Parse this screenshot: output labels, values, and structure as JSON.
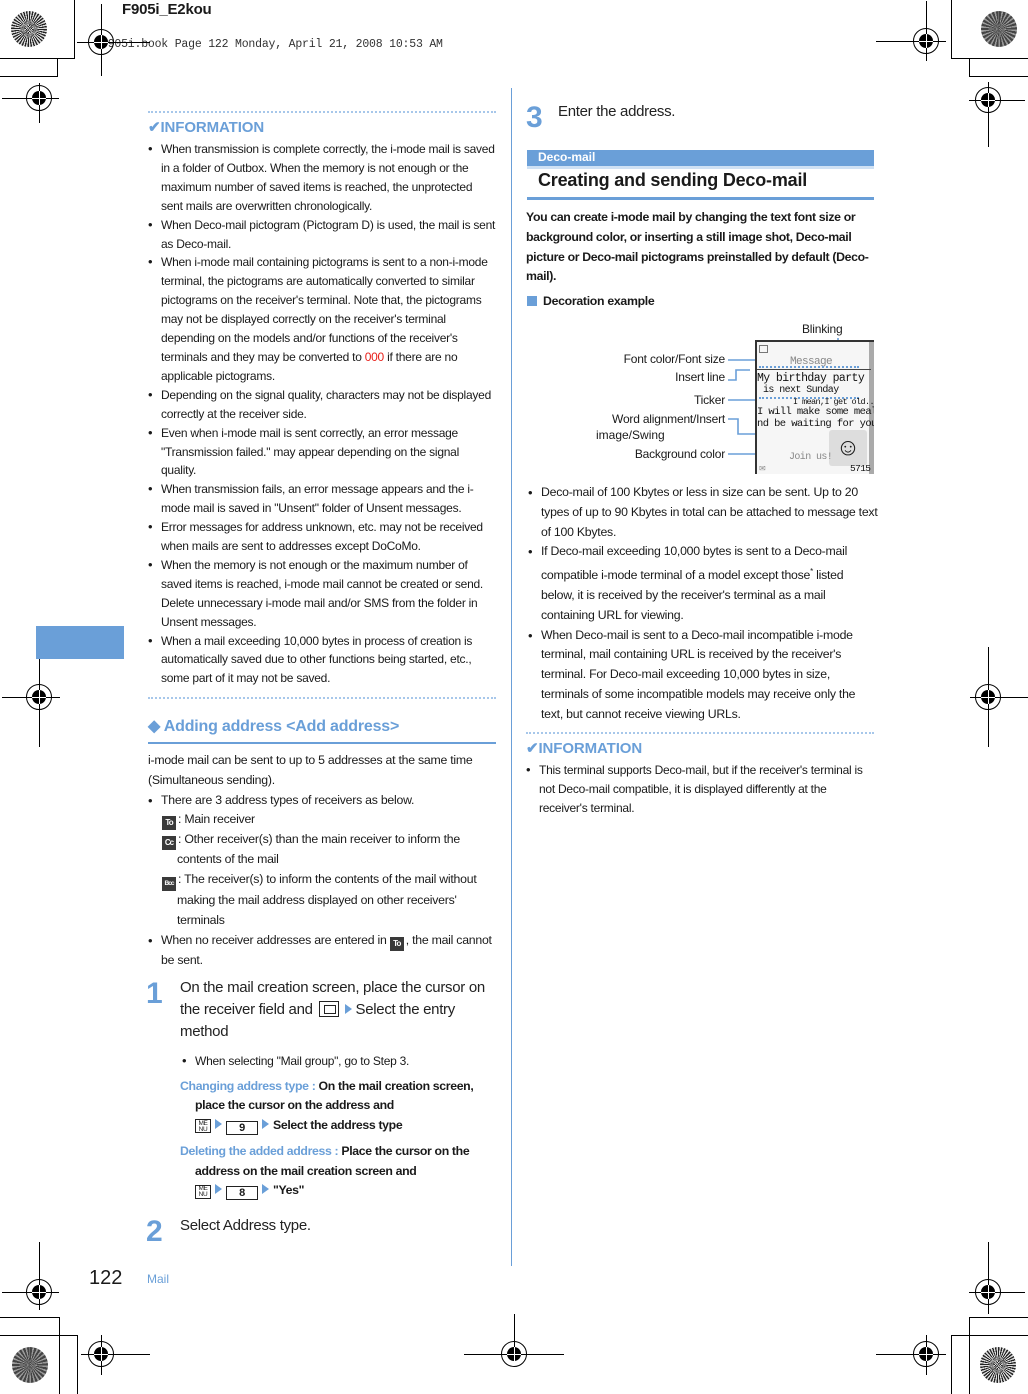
{
  "header": {
    "job_name": "F905i_E2kou",
    "print_stamp": "F905i.book  Page 122  Monday, April 21, 2008  10:53 AM"
  },
  "footer": {
    "page_number": "122",
    "section": "Mail"
  },
  "left_column": {
    "info_box": {
      "title_icon": "check-icon",
      "title": "INFORMATION",
      "bullets": [
        "When transmission is complete correctly, the i-mode mail is saved in a folder of Outbox. When the memory is not enough or the maximum number of saved items is reached, the unprotected sent mails are overwritten chronologically.",
        "When Deco-mail pictogram (Pictogram D) is used, the mail is sent as Deco-mail.",
        {
          "before": "When i-mode mail containing pictograms is sent to a non-i-mode terminal, the pictograms are automatically converted to similar pictograms on the receiver's terminal. Note that, the pictograms may not be displayed correctly on the receiver's terminal depending on the models and/or functions of the receiver's terminals and they may be converted to ",
          "highlight": "000",
          "after": " if there are no applicable pictograms."
        },
        "Depending on the signal quality, characters may not be displayed correctly at the receiver side.",
        "Even when i-mode mail is sent correctly, an error message \"Transmission failed.\" may appear depending on the signal quality.",
        "When transmission fails, an error message appears and the i-mode mail is saved in \"Unsent\" folder of Unsent messages.",
        "Error messages for address unknown, etc. may not be received when mails are sent to addresses except DoCoMo.",
        "When the memory is not enough or the maximum number of saved items is reached, i-mode mail cannot be created or send. Delete unnecessary i-mode mail and/or SMS from the folder in Unsent messages.",
        "When a mail exceeding 10,000 bytes in process of creation is automatically saved due to other functions being started, etc., some part of it may not be saved."
      ]
    },
    "add_address": {
      "heading_icon": "diamond-icon",
      "heading": "Adding address <Add address>",
      "intro": "i-mode mail can be sent to up to 5 addresses at the same time (Simultaneous sending).",
      "bullet_types": "There are 3 address types of receivers as below.",
      "types": [
        {
          "badge": "To",
          "text": ": Main receiver"
        },
        {
          "badge": "Cc",
          "text": ": Other receiver(s) than the main receiver to inform the contents of the mail"
        },
        {
          "badge": "Bcc",
          "text": ": The receiver(s) to inform the contents of the mail without making the mail address displayed on other receivers' terminals"
        }
      ],
      "bullet_no_receiver_before": "When no receiver addresses are entered in",
      "bullet_no_receiver_badge": "To",
      "bullet_no_receiver_after": ", the mail cannot be sent."
    },
    "steps": [
      {
        "number": "1",
        "text_before": "On the mail creation screen, place the cursor on the receiver field and",
        "key_icon": "mail-key-icon",
        "text_after": "Select the entry method",
        "sub_bullet": "When selecting \"Mail group\", go to Step 3.",
        "operations": [
          {
            "label": "Changing address type :",
            "text_before": "On the mail creation screen, place the cursor on the address and",
            "menu_key": "MENU",
            "key": "9",
            "text_after": "Select the address type"
          },
          {
            "label": "Deleting the added address :",
            "text_before": "Place the cursor on the address on the mail creation screen and",
            "menu_key": "MENU",
            "key": "8",
            "text_after": "\"Yes\""
          }
        ]
      },
      {
        "number": "2",
        "text": "Select Address type."
      }
    ]
  },
  "right_column": {
    "step3": {
      "number": "3",
      "text": "Enter the address."
    },
    "section_band": "Deco-mail",
    "section_title": "Creating and sending Deco-mail",
    "intro": "You can create i-mode mail by changing the text font size or background color, or inserting a still image shot, Deco-mail picture or Deco-mail pictograms preinstalled by default (Deco-mail).",
    "decoration_heading": "Decoration example",
    "diagram": {
      "labels": {
        "blinking": "Blinking",
        "font": "Font color/Font size",
        "insert_line": "Insert line",
        "ticker": "Ticker",
        "word_align_1": "Word alignment/Insert",
        "word_align_2": "image/Swing",
        "background": "Background color"
      },
      "screen": {
        "subject": "Message",
        "line1": "My birthday party",
        "line2": "is next Sunday",
        "ticker": "I mean,I get old...",
        "line3": "I will make some meal a",
        "line4": "nd be waiting for you.",
        "join": "Join us!",
        "counter": "5715"
      }
    },
    "bullets": [
      "Deco-mail of 100 Kbytes or less in size can be sent. Up to 20 types of up to 90 Kbytes in total can be attached to message text of 100 Kbytes.",
      {
        "before": "If Deco-mail exceeding 10,000 bytes is sent to a Deco-mail compatible i-mode terminal of a model except those",
        "sup": "*",
        "after": " listed below, it is received by the receiver's terminal as a mail containing URL for viewing."
      },
      "When Deco-mail is sent to a Deco-mail incompatible i-mode terminal, mail containing URL is received by the receiver's terminal. For Deco-mail exceeding 10,000 bytes in size, terminals of some incompatible models may receive only the text, but cannot receive viewing URLs."
    ],
    "info_box": {
      "title_icon": "check-icon",
      "title": "INFORMATION",
      "bullets": [
        "This terminal supports Deco-mail, but if  the receiver's terminal is not Deco-mail compatible, it is displayed differently at the receiver's terminal."
      ]
    }
  },
  "colors": {
    "accent": "#6a9fd8",
    "accent_light": "#a7c7ea",
    "highlight_red": "#e8201a",
    "text": "#1a1a1a"
  }
}
